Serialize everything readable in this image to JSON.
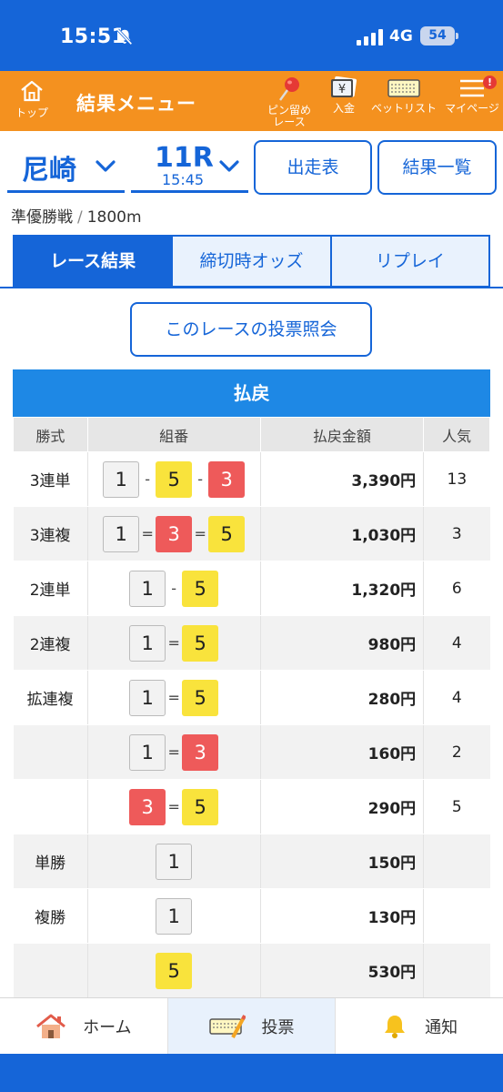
{
  "status_bar": {
    "time": "15:51",
    "network": "4G",
    "battery": "54"
  },
  "header": {
    "home_label": "トップ",
    "title": "結果メニュー",
    "pin_label_1": "ピン留め",
    "pin_label_2": "レース",
    "deposit_label": "入金",
    "betlist_label": "ベットリスト",
    "mypage_label": "マイページ",
    "mypage_badge": "!"
  },
  "selector": {
    "venue": "尼崎",
    "race_number": "11R",
    "race_time": "15:45",
    "entry_list_button": "出走表",
    "results_list_button": "結果一覧"
  },
  "race_info": {
    "grade": "準優勝戦",
    "separator": "/",
    "distance": "1800m"
  },
  "tabs": [
    "レース結果",
    "締切時オッズ",
    "リプレイ"
  ],
  "vote_inquiry_button": "このレースの投票照会",
  "payout": {
    "title": "払戻",
    "headers": [
      "勝式",
      "組番",
      "払戻金額",
      "人気"
    ],
    "rows": [
      {
        "type": "3連単",
        "combo": [
          "1",
          "-",
          "5",
          "-",
          "3"
        ],
        "amount": "3,390円",
        "popularity": "13"
      },
      {
        "type": "3連複",
        "combo": [
          "1",
          "=",
          "3",
          "=",
          "5"
        ],
        "amount": "1,030円",
        "popularity": "3"
      },
      {
        "type": "2連単",
        "combo": [
          "1",
          "-",
          "5"
        ],
        "amount": "1,320円",
        "popularity": "6"
      },
      {
        "type": "2連複",
        "combo": [
          "1",
          "=",
          "5"
        ],
        "amount": "980円",
        "popularity": "4"
      },
      {
        "type": "拡連複",
        "combo": [
          "1",
          "=",
          "5"
        ],
        "amount": "280円",
        "popularity": "4"
      },
      {
        "type": "",
        "combo": [
          "1",
          "=",
          "3"
        ],
        "amount": "160円",
        "popularity": "2"
      },
      {
        "type": "",
        "combo": [
          "3",
          "=",
          "5"
        ],
        "amount": "290円",
        "popularity": "5"
      },
      {
        "type": "単勝",
        "combo": [
          "1"
        ],
        "amount": "150円",
        "popularity": ""
      },
      {
        "type": "複勝",
        "combo": [
          "1"
        ],
        "amount": "130円",
        "popularity": ""
      },
      {
        "type": "",
        "combo": [
          "5"
        ],
        "amount": "530円",
        "popularity": ""
      }
    ]
  },
  "bottom_nav": {
    "home": "ホーム",
    "vote": "投票",
    "notify": "通知"
  },
  "colors": {
    "accent_blue": "#1565d8",
    "header_orange": "#f4911f",
    "boat_1": "#f2f2f2",
    "boat_3": "#ee5a5a",
    "boat_5": "#f9e33c"
  },
  "icons": {
    "home": "home-icon",
    "pin": "pushpin-icon",
    "deposit": "yen-deposit-icon",
    "betlist": "ticket-list-icon",
    "mypage": "menu-icon",
    "nav_home": "house-icon",
    "nav_vote": "vote-ticket-icon",
    "nav_notify": "bell-icon"
  }
}
